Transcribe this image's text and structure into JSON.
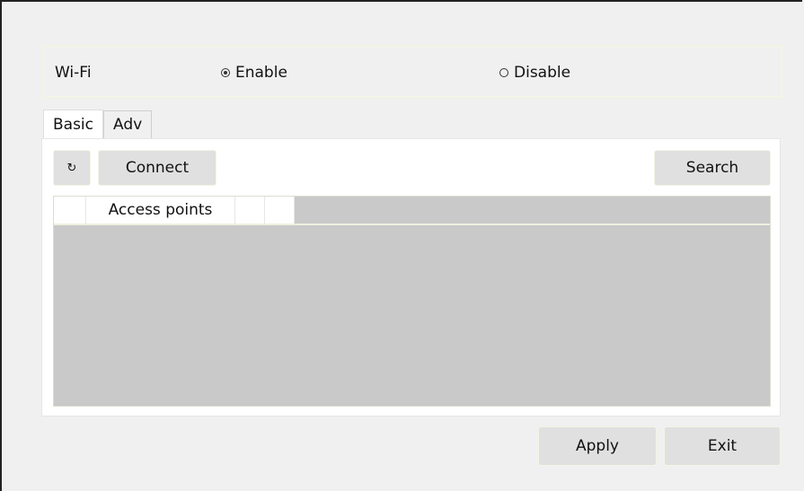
{
  "wifi": {
    "label": "Wi-Fi",
    "options": [
      {
        "label": "Enable",
        "selected": true
      },
      {
        "label": "Disable",
        "selected": false
      }
    ]
  },
  "tabs": [
    {
      "label": "Basic",
      "active": true
    },
    {
      "label": "Adv",
      "active": false
    }
  ],
  "toolbar": {
    "refresh_glyph": "↻",
    "connect_label": "Connect",
    "search_label": "Search"
  },
  "access_points": {
    "columns": [
      "",
      "Access points",
      "",
      ""
    ],
    "rows": []
  },
  "footer": {
    "apply_label": "Apply",
    "exit_label": "Exit"
  },
  "icons": {
    "refresh": "refresh-icon"
  },
  "colors": {
    "window_bg": "#f0f0f0",
    "button_bg": "#e0e0e0",
    "list_bg": "#c9c9c9"
  }
}
